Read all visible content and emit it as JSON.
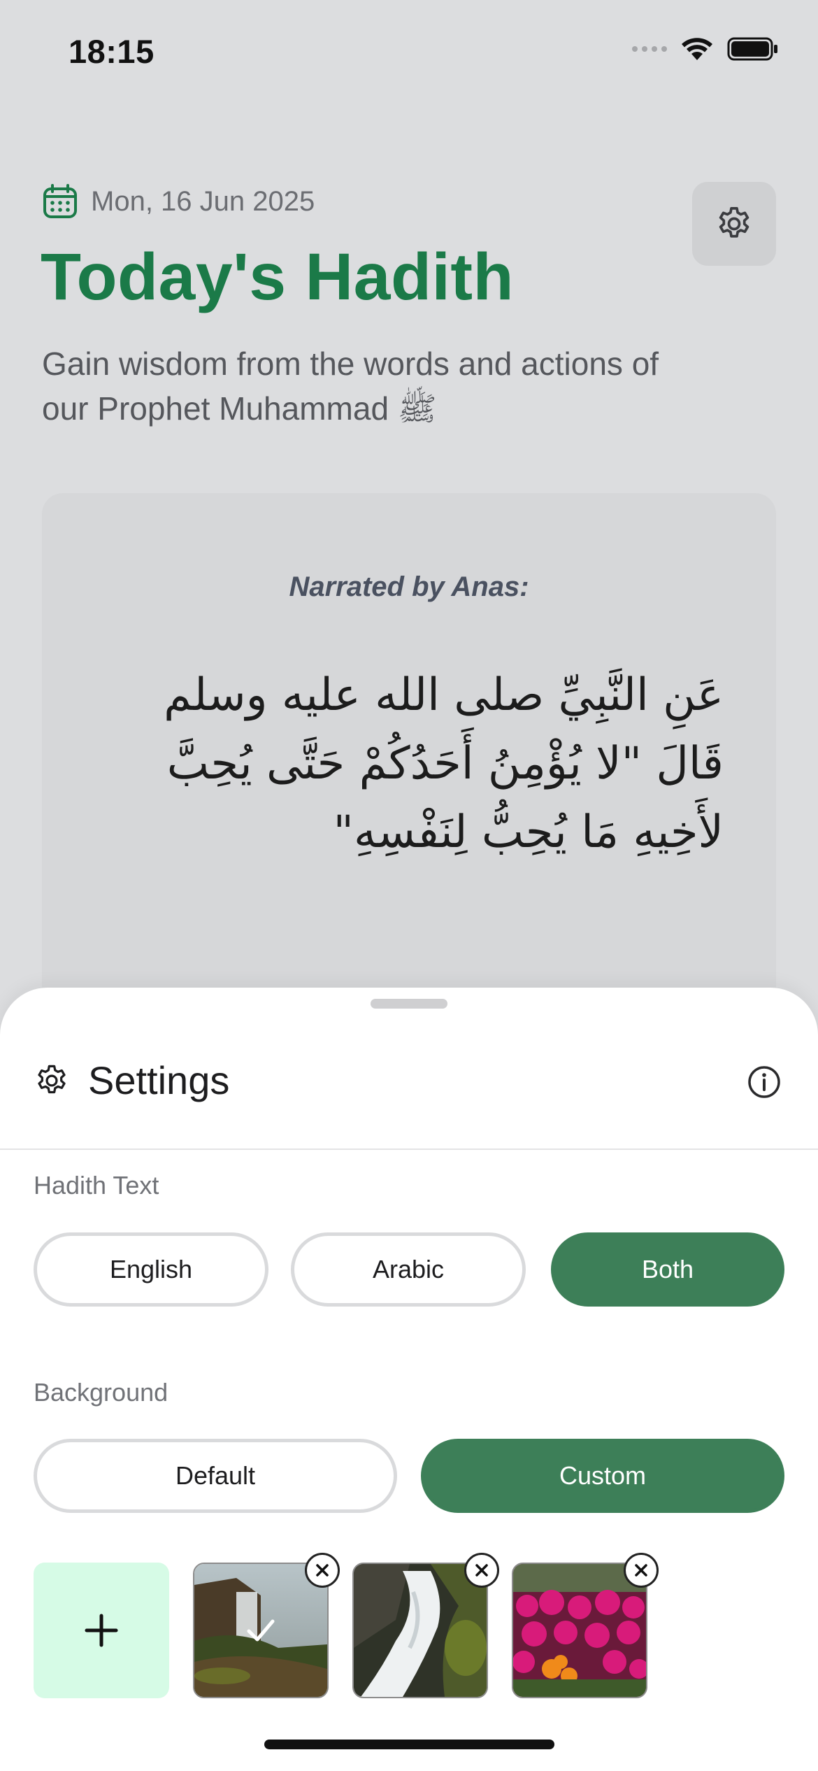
{
  "status_bar": {
    "time": "18:15"
  },
  "header": {
    "date": "Mon, 16 Jun 2025",
    "title": "Today's Hadith",
    "subtitle": "Gain wisdom from the words and actions of our Prophet Muhammad ﷺ"
  },
  "hadith": {
    "narrator": "Narrated by Anas:",
    "arabic": "عَنِ النَّبِيِّ صلى الله عليه وسلم قَالَ \"لا يُؤْمِنُ أَحَدُكُمْ حَتَّى يُحِبَّ لأَخِيهِ مَا يُحِبُّ لِنَفْسِهِ\""
  },
  "settings": {
    "title": "Settings",
    "hadith_text": {
      "label": "Hadith Text",
      "options": [
        "English",
        "Arabic",
        "Both"
      ],
      "selected": "Both"
    },
    "background": {
      "label": "Background",
      "options": [
        "Default",
        "Custom"
      ],
      "selected": "Custom",
      "add_glyph": "+",
      "thumbnails": [
        "waterfall-cliff",
        "waterfall-rocks",
        "flower-garden"
      ],
      "selected_thumbnail": 0
    }
  },
  "colors": {
    "accent": "#3d7f58",
    "title_green": "#1b7a48",
    "add_tile": "#d6fbe6",
    "background": "#dcdddf"
  },
  "icons": {
    "date": "calendar-icon",
    "settings": "gear-icon",
    "info": "info-icon",
    "add": "plus-icon",
    "remove": "close-icon",
    "selected": "checkmark-icon"
  }
}
